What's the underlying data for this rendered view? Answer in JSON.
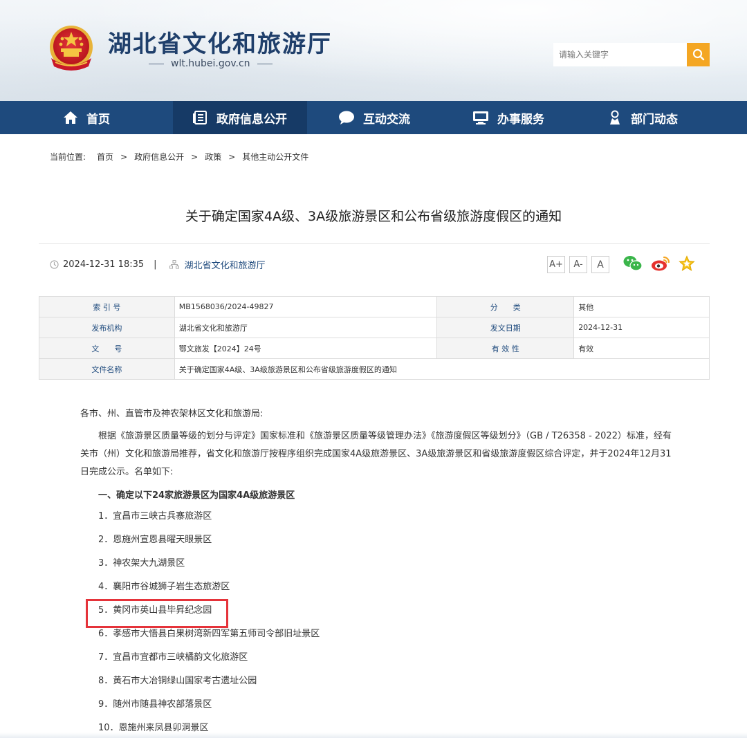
{
  "header": {
    "site_title": "湖北省文化和旅游厅",
    "site_url": "wlt.hubei.gov.cn",
    "search_placeholder": "请输入关键字"
  },
  "nav": {
    "items": [
      {
        "label": "首页",
        "icon": "home-icon"
      },
      {
        "label": "政府信息公开",
        "icon": "document-list-icon",
        "active": true
      },
      {
        "label": "互动交流",
        "icon": "chat-bubble-icon"
      },
      {
        "label": "办事服务",
        "icon": "monitor-icon"
      },
      {
        "label": "部门动态",
        "icon": "person-icon"
      }
    ]
  },
  "breadcrumb": {
    "prefix": "当前位置:",
    "items": [
      "首页",
      "政府信息公开",
      "政策",
      "其他主动公开文件"
    ],
    "separator": ">"
  },
  "article": {
    "title": "关于确定国家4A级、3A级旅游景区和公布省级旅游度假区的通知",
    "datetime": "2024-12-31 18:35",
    "divider": "|",
    "publisher": "湖北省文化和旅游厅",
    "font_buttons": [
      "A+",
      "A-",
      "A"
    ]
  },
  "info_table": {
    "rows": [
      [
        {
          "label": "索 引 号",
          "value": "MB1568036/2024-49827"
        },
        {
          "label": "分　　类",
          "value": "其他"
        }
      ],
      [
        {
          "label": "发布机构",
          "value": "湖北省文化和旅游厅"
        },
        {
          "label": "发文日期",
          "value": "2024-12-31"
        }
      ],
      [
        {
          "label": "文　　号",
          "value": "鄂文旅发【2024】24号"
        },
        {
          "label": "有 效 性",
          "value": "有效"
        }
      ]
    ],
    "file_name_label": "文件名称",
    "file_name_value": "关于确定国家4A级、3A级旅游景区和公布省级旅游度假区的通知"
  },
  "body": {
    "greeting": "各市、州、直管市及神农架林区文化和旅游局:",
    "paragraph": "根据《旅游景区质量等级的划分与评定》国家标准和《旅游景区质量等级管理办法》《旅游度假区等级划分》（GB / T26358 - 2022）标准，经有关市（州）文化和旅游局推荐，省文化和旅游厅按程序组织完成国家4A级旅游景区、3A级旅游景区和省级旅游度假区综合评定，并于2024年12月31日完成公示。名单如下:",
    "section_heading": "一、确定以下24家旅游景区为国家4A级旅游景区",
    "list": [
      "1．宜昌市三峡古兵寨旅游区",
      "2．恩施州宣恩县曜天眼景区",
      "3．神农架大九湖景区",
      "4．襄阳市谷城狮子岩生态旅游区",
      "5．黄冈市英山县毕昇纪念园",
      "6．孝感市大悟县白果树湾新四军第五师司令部旧址景区",
      "7．宜昌市宜都市三峡橘韵文化旅游区",
      "8．黄石市大冶铜绿山国家考古遗址公园",
      "9．随州市随县神农部落景区",
      "10．恩施州来凤县卯洞景区"
    ]
  },
  "colors": {
    "nav_bg": "#1e4a7d",
    "nav_active": "#163a66",
    "search_button": "#f4a623",
    "highlight_border": "#e5333a"
  }
}
